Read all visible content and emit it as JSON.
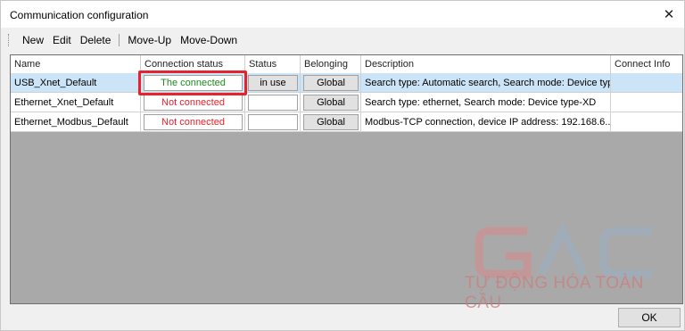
{
  "window": {
    "title": "Communication configuration",
    "close_glyph": "✕"
  },
  "toolbar": {
    "items": [
      "New",
      "Edit",
      "Delete",
      "Move-Up",
      "Move-Down"
    ]
  },
  "table": {
    "columns": [
      "Name",
      "Connection status",
      "Status",
      "Belonging",
      "Description",
      "Connect Info"
    ],
    "rows": [
      {
        "name": "USB_Xnet_Default",
        "connection_status": "The connected",
        "status": "in use",
        "belonging": "Global",
        "description": "Search type: Automatic search, Search mode: Device typ...",
        "connect_info": ""
      },
      {
        "name": "Ethernet_Xnet_Default",
        "connection_status": "Not connected",
        "status": "",
        "belonging": "Global",
        "description": "Search type: ethernet, Search mode: Device type-XD",
        "connect_info": ""
      },
      {
        "name": "Ethernet_Modbus_Default",
        "connection_status": "Not connected",
        "status": "",
        "belonging": "Global",
        "description": "Modbus-TCP connection, device IP address: 192.168.6....",
        "connect_info": ""
      }
    ]
  },
  "watermark": {
    "logo": "GAC",
    "subtitle": "TỰ ĐỘNG HÓA TOÀN CẦU"
  },
  "footer": {
    "ok_label": "OK"
  },
  "colors": {
    "connected": "#1e8a1e",
    "not_connected": "#e8212a",
    "selected_row": "#cce4f7",
    "highlight": "#e8212a",
    "grid_background": "#a9a9a9"
  }
}
